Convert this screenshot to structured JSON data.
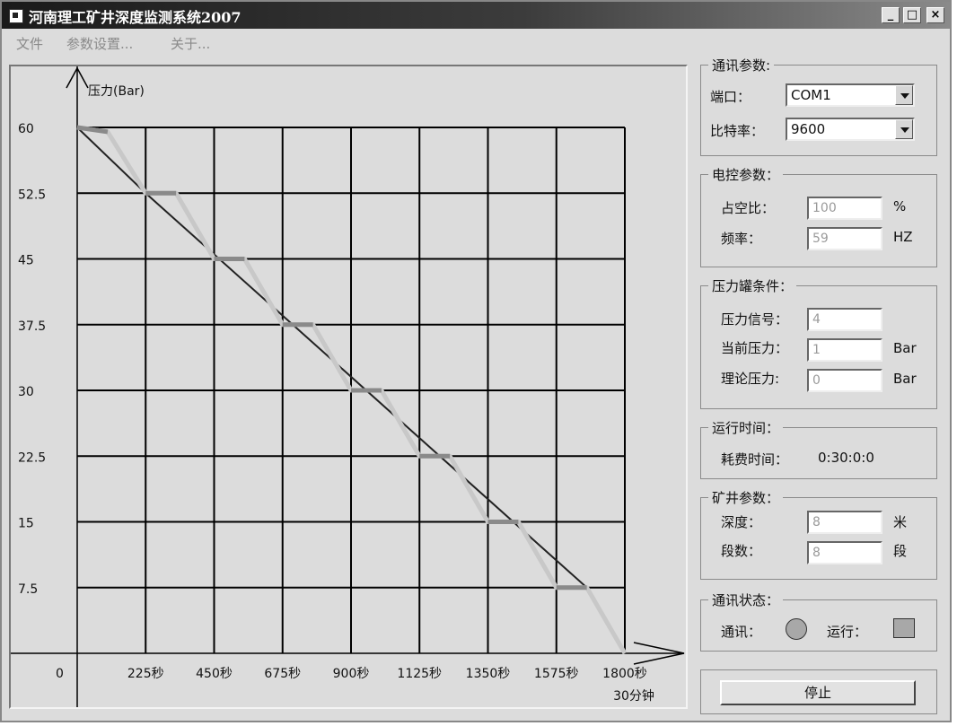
{
  "window": {
    "title": "河南理工矿井深度监测系统2007",
    "minimize_label": "_",
    "maximize_label": "□",
    "close_label": "×"
  },
  "menu": {
    "items": [
      "文件",
      "参数设置...",
      "关于..."
    ]
  },
  "chart_data": {
    "type": "line",
    "ylabel": "压力(Bar)",
    "y_ticks": [
      "60",
      "52.5",
      "45",
      "37.5",
      "30",
      "22.5",
      "15",
      "7.5"
    ],
    "y_origin_label": "0",
    "x_ticks": [
      "225秒",
      "450秒",
      "675秒",
      "900秒",
      "1125秒",
      "1350秒",
      "1575秒",
      "1800秒"
    ],
    "x_end_label": "30分钟",
    "xlim": [
      0,
      1800
    ],
    "ylim": [
      0,
      60
    ],
    "grid": true,
    "series": [
      {
        "values_x": [
          0,
          100,
          225,
          325,
          450,
          550,
          675,
          775,
          900,
          1000,
          1125,
          1225,
          1350,
          1450,
          1575,
          1675,
          1800
        ],
        "values_y": [
          60,
          59.5,
          52.5,
          52.5,
          45,
          45,
          37.5,
          37.5,
          30,
          30,
          22.5,
          22.5,
          15,
          15,
          7.5,
          7.5,
          0
        ]
      },
      {
        "values_x": [
          0,
          225,
          1675,
          1800
        ],
        "values_y": [
          60,
          52.5,
          7.5,
          0
        ]
      }
    ]
  },
  "comm": {
    "title": "通讯参数:",
    "port_label": "端口：",
    "port_value": "COM1",
    "baud_label": "比特率：",
    "baud_value": "9600"
  },
  "electric": {
    "title": "电控参数：",
    "duty_label": "占空比：",
    "duty_value": "100",
    "duty_unit": "%",
    "freq_label": "频率：",
    "freq_value": "59",
    "freq_unit": "HZ"
  },
  "tank": {
    "title": "压力罐条件：",
    "signal_label": "压力信号：",
    "signal_value": "4",
    "current_label": "当前压力：",
    "current_value": "1",
    "current_unit": "Bar",
    "theory_label": "理论压力:",
    "theory_value": "0",
    "theory_unit": "Bar"
  },
  "runtime": {
    "title": "运行时间：",
    "elapsed_label": "耗费时间：",
    "elapsed_value": "0:30:0:0"
  },
  "mine": {
    "title": "矿井参数：",
    "depth_label": "深度：",
    "depth_value": "8",
    "depth_unit": "米",
    "segments_label": "段数：",
    "segments_value": "8",
    "segments_unit": "段"
  },
  "status": {
    "title": "通讯状态：",
    "comm_label": "通讯：",
    "run_label": "运行："
  },
  "stop_button": "停止"
}
